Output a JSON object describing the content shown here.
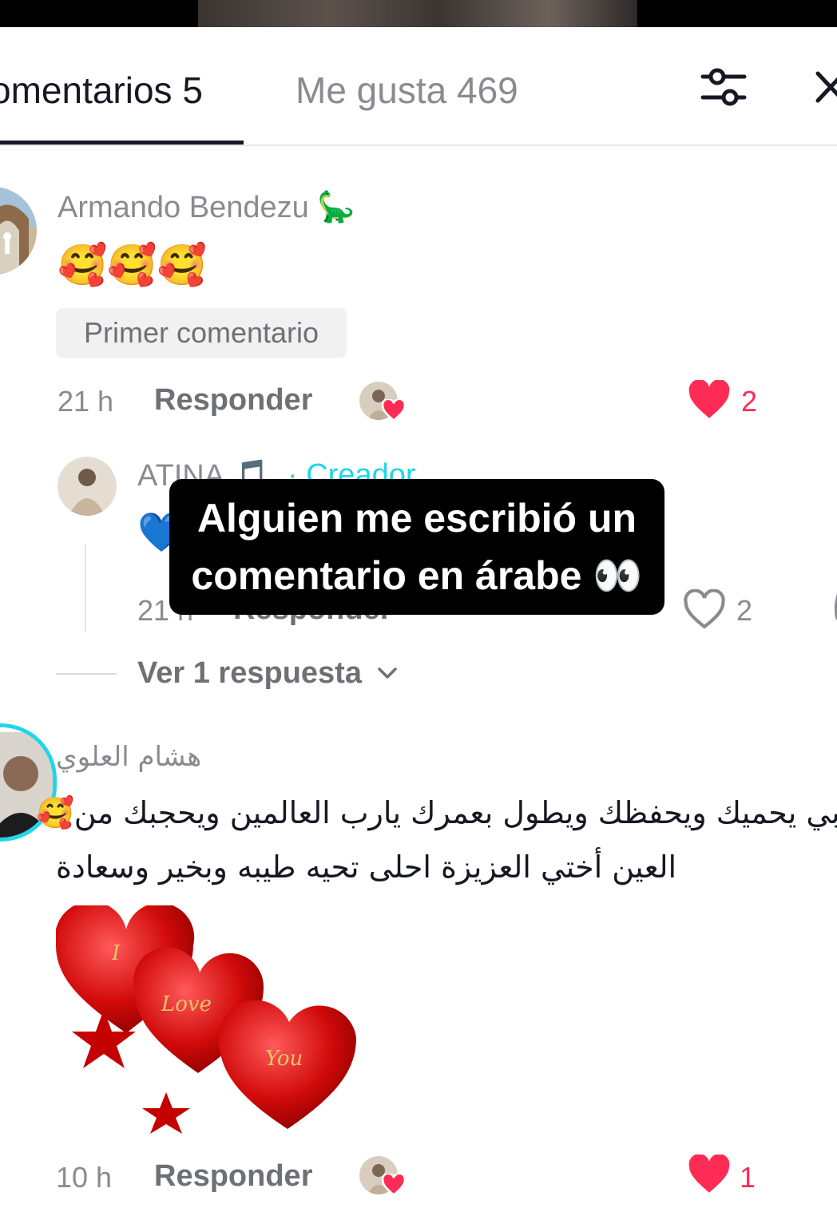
{
  "tabs": {
    "comments_label": "omentarios 5",
    "likes_label": "Me gusta 469"
  },
  "icons": {
    "filter": "filter-sliders-icon",
    "close": "close-icon",
    "heart": "heart-icon",
    "dino": "sauropod-emoji"
  },
  "colors": {
    "accent": "#fe2c55",
    "creator": "#20d5ec",
    "text": "#161823",
    "muted": "#8a8b91"
  },
  "comments": [
    {
      "username": "Armando Bendezu 🦕",
      "text": "🥰🥰🥰",
      "badge": "Primer comentario",
      "time": "21 h",
      "reply_label": "Responder",
      "likes": "2",
      "liked": true
    },
    {
      "username": "ATINA 🎵",
      "creator_label": "· Creador",
      "text": "💙",
      "time": "21 h",
      "reply_label": "Responder",
      "likes": "2",
      "liked": false
    },
    {
      "username": "هشام العلوي",
      "text_line1": "ربي يحميك ويحفظك ويطول بعمرك يارب العالمين ويحجبك من🥰",
      "text_line2": "العين أختي العزيزة احلى تحيه طيبه وبخير وسعادة",
      "gif_words": [
        "I",
        "Love",
        "You"
      ],
      "time": "10 h",
      "reply_label": "Responder",
      "likes": "1",
      "liked": true
    }
  ],
  "view_replies": "Ver 1 respuesta",
  "caption": {
    "line1": "Alguien me escribió un",
    "line2": "comentario en árabe 👀"
  }
}
